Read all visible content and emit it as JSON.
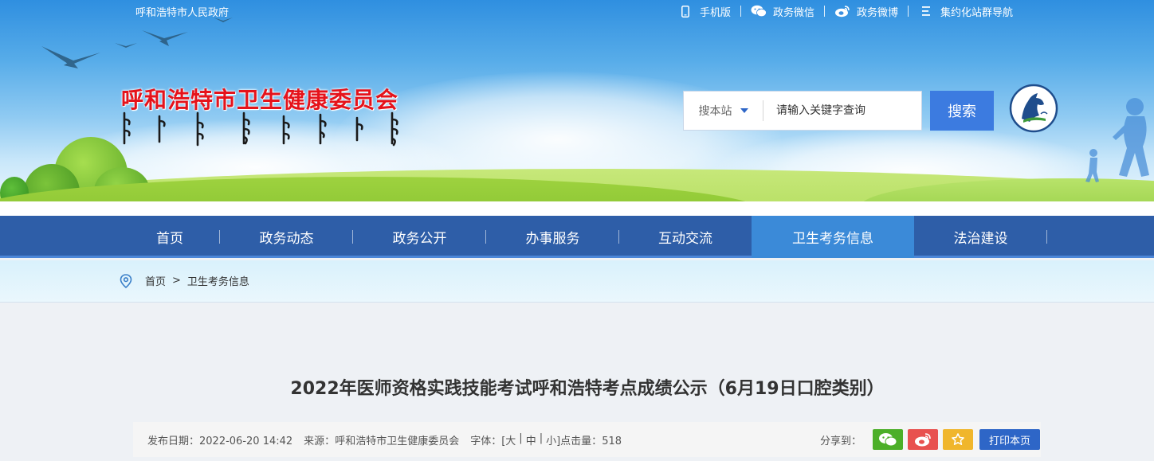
{
  "topbar": {
    "site_name": "呼和浩特市人民政府",
    "links": [
      {
        "label": "手机版",
        "icon": "mobile-icon"
      },
      {
        "label": "政务微信",
        "icon": "wechat-icon"
      },
      {
        "label": "政务微博",
        "icon": "weibo-icon"
      },
      {
        "label": "集约化站群导航",
        "icon": "menu-icon"
      }
    ]
  },
  "header": {
    "title": "呼和浩特市卫生健康委员会",
    "title_color": "#e5131b"
  },
  "search": {
    "scope": "搜本站",
    "placeholder": "请输入关键字查询",
    "button": "搜索",
    "button_color": "#3c7be0"
  },
  "nav": {
    "items": [
      {
        "label": "首页",
        "active": false
      },
      {
        "label": "政务动态",
        "active": false
      },
      {
        "label": "政务公开",
        "active": false
      },
      {
        "label": "办事服务",
        "active": false
      },
      {
        "label": "互动交流",
        "active": false
      },
      {
        "label": "卫生考务信息",
        "active": true
      },
      {
        "label": "法治建设",
        "active": false
      }
    ],
    "bg_color": "#2e5ea8",
    "active_color": "#3b8ad8"
  },
  "breadcrumb": {
    "home": "首页",
    "separator": ">",
    "current": "卫生考务信息"
  },
  "article": {
    "title": "2022年医师资格实践技能考试呼和浩特考点成绩公示（6月19日口腔类别）",
    "publish_label": "发布日期：",
    "publish_date": "2022-06-20 14:42",
    "source_label": "来源：",
    "source": "呼和浩特市卫生健康委员会",
    "font_label": "字体：",
    "font_sizes": [
      "[大",
      "|",
      "中",
      "|",
      "小]"
    ],
    "hits_label": "点击量：",
    "hits": "518",
    "share_label": "分享到：",
    "share_buttons": [
      {
        "icon": "wechat-share-icon",
        "color": "#4caf28"
      },
      {
        "icon": "weibo-share-icon",
        "color": "#e8514f"
      },
      {
        "icon": "favorite-star-icon",
        "color": "#f0b62c"
      }
    ],
    "print": "打印本页"
  }
}
